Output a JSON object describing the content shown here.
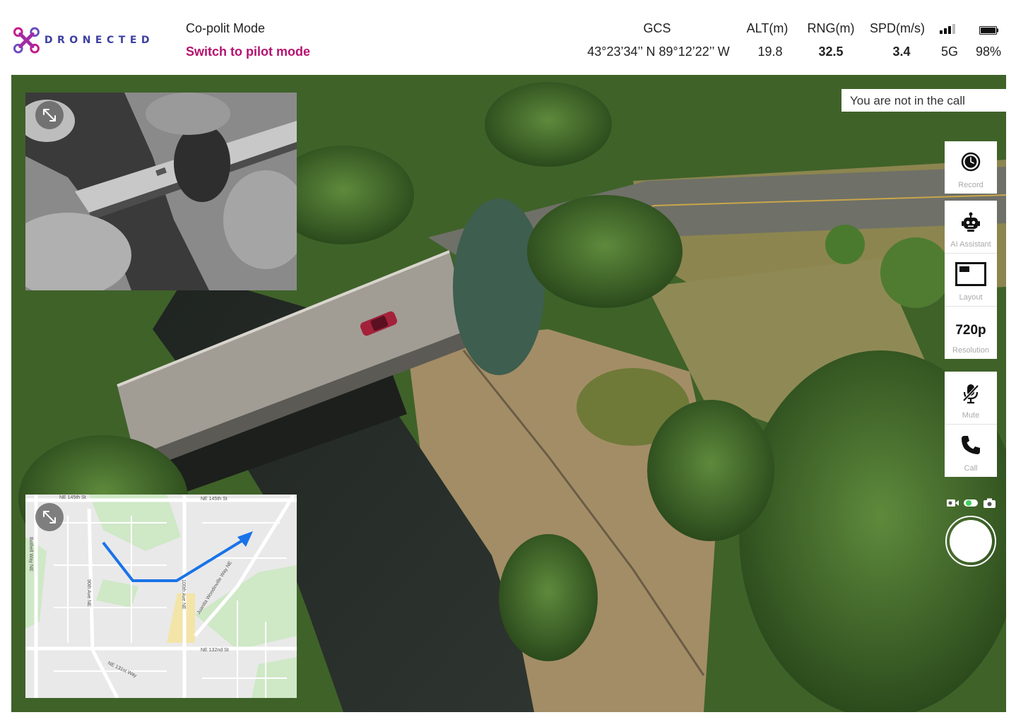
{
  "header": {
    "brand": "DRONECTED",
    "mode_title": "Co-polit Mode",
    "mode_switch": "Switch to pilot mode",
    "stats": [
      {
        "label": "GCS",
        "value": "43°23’34’’ N 89°12’22’’ W"
      },
      {
        "label": "ALT(m)",
        "value": "19.8"
      },
      {
        "label": "RNG(m)",
        "value": "32.5"
      },
      {
        "label": "SPD(m/s)",
        "value": "3.4"
      },
      {
        "label": "signal-icon",
        "value": "5G"
      },
      {
        "label": "battery-icon",
        "value": "98%"
      }
    ]
  },
  "call_status": "You are not in the call",
  "controls": {
    "record": "Record",
    "ai_assistant": "AI Assistant",
    "layout": "Layout",
    "resolution_value": "720p",
    "resolution": "Resolution",
    "mute": "Mute",
    "call": "Call"
  },
  "map": {
    "streets": [
      "NE 145th St",
      "NE 145th St",
      "Bothell Way NE",
      "90th Ave NE",
      "NE 132nd St",
      "NE 131st Way",
      "Juanita Woodinville Way NE",
      "100th Ave NE"
    ],
    "route_color": "#1a73e8"
  },
  "colors": {
    "brand": "#3c3fa0",
    "accent": "#b5136f",
    "status_green": "#3ecf5a"
  }
}
